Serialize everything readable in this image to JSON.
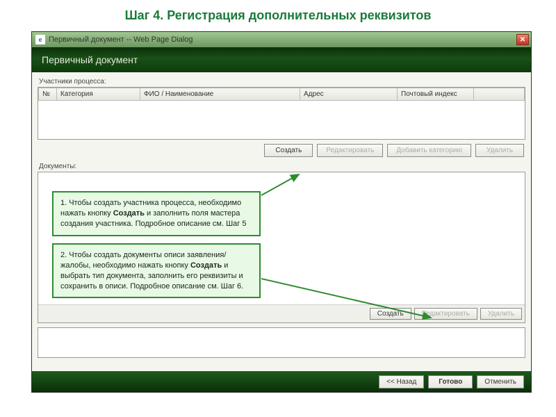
{
  "page_heading": "Шаг 4. Регистрация дополнительных реквизитов",
  "titlebar": {
    "icon_letter": "e",
    "text": "Первичный документ -- Web Page Dialog"
  },
  "header_band": "Первичный документ",
  "participants": {
    "label": "Участники процесса:",
    "cols": [
      "№",
      "Категория",
      "ФИО / Наименование",
      "Адрес",
      "Почтовый индекс",
      ""
    ],
    "buttons": {
      "create": "Создать",
      "edit": "Редактировать",
      "add_cat": "Добавить категорию",
      "delete": "Удалить"
    }
  },
  "documents": {
    "label": "Документы:",
    "buttons": {
      "create": "Создать",
      "edit": "Редактировать",
      "delete": "Удалить"
    }
  },
  "bottom": {
    "back": "<< Назад",
    "done": "Готово",
    "cancel": "Отменить"
  },
  "callout1": {
    "pre": "1. Чтобы создать участника процесса, необходимо нажать кнопку ",
    "bold": "Создать",
    "post": " и заполнить поля мастера создания участника. Подробное описание см. Шаг 5"
  },
  "callout2": {
    "pre": "2. Чтобы создать документы описи заявления/жалобы, необходимо нажать кнопку ",
    "bold": "Создать",
    "post": " и  выбрать тип документа, заполнить его реквизиты и сохранить в описи. Подробное описание см. Шаг 6."
  }
}
